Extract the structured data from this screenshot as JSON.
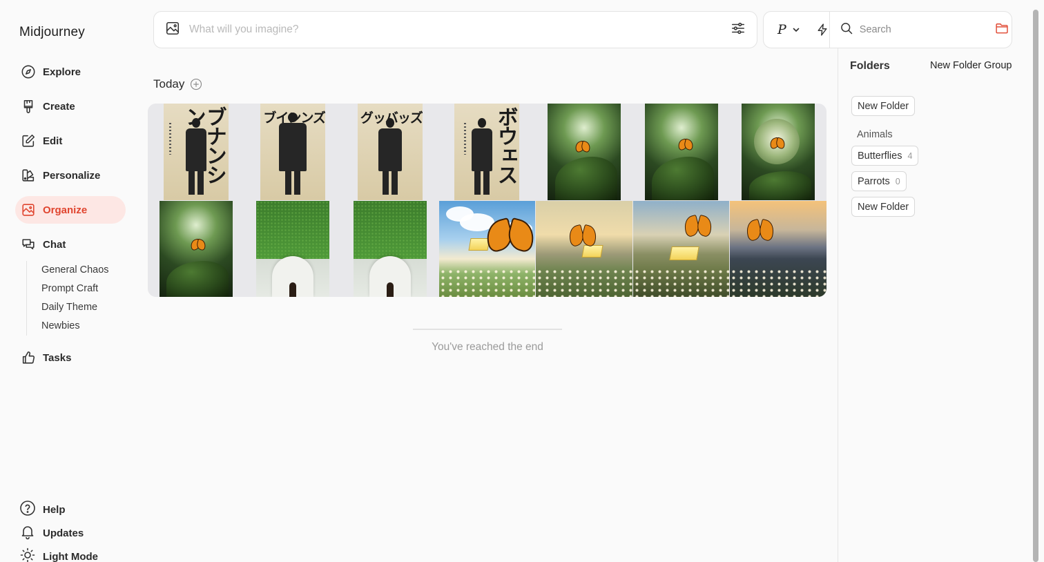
{
  "app": {
    "brand": "Midjourney"
  },
  "sidebar": {
    "nav": [
      {
        "label": "Explore",
        "icon": "compass-icon"
      },
      {
        "label": "Create",
        "icon": "brush-icon"
      },
      {
        "label": "Edit",
        "icon": "edit-icon"
      },
      {
        "label": "Personalize",
        "icon": "palette-icon"
      },
      {
        "label": "Organize",
        "icon": "image-frame-icon",
        "active": true
      },
      {
        "label": "Chat",
        "icon": "chat-bubbles-icon"
      },
      {
        "label": "Tasks",
        "icon": "thumbs-up-icon"
      }
    ],
    "chat_channels": [
      "General Chaos",
      "Prompt Craft",
      "Daily Theme",
      "Newbies"
    ],
    "footer": [
      {
        "label": "Help",
        "icon": "help-circle-icon"
      },
      {
        "label": "Updates",
        "icon": "bell-icon"
      },
      {
        "label": "Light Mode",
        "icon": "sun-icon"
      }
    ]
  },
  "topbar": {
    "prompt_placeholder": "What will you imagine?",
    "mode_letter": "P",
    "search_placeholder": "Search"
  },
  "main": {
    "section_title": "Today",
    "end_message": "You've reached the end",
    "gallery": [
      {
        "kind": "poster",
        "text": "ブナンシン",
        "layout": "vertical"
      },
      {
        "kind": "poster",
        "text": "ブインンズ",
        "layout": "horizontal"
      },
      {
        "kind": "poster",
        "text": "グッバッズ",
        "layout": "horizontal"
      },
      {
        "kind": "poster",
        "text": "ボウェス",
        "layout": "vertical"
      },
      {
        "kind": "forest-butterfly"
      },
      {
        "kind": "forest-butterfly"
      },
      {
        "kind": "bubble-butterfly"
      },
      {
        "kind": "forest-butterfly"
      },
      {
        "kind": "hedge-door"
      },
      {
        "kind": "hedge-door"
      },
      {
        "kind": "sky-butterfly-butter"
      },
      {
        "kind": "sunset-butterfly-butter"
      },
      {
        "kind": "valley-butterfly-butter"
      },
      {
        "kind": "dusk-butterfly"
      }
    ]
  },
  "folders": {
    "title": "Folders",
    "new_group_label": "New Folder Group",
    "new_folder_label": "New Folder",
    "group_name": "Animals",
    "items": [
      {
        "name": "Butterflies",
        "count": "4"
      },
      {
        "name": "Parrots",
        "count": "0"
      }
    ],
    "bottom_new_folder_label": "New Folder"
  },
  "colors": {
    "accent": "#e0452f",
    "active_bg": "#fde7e4",
    "background": "#fafafa"
  }
}
